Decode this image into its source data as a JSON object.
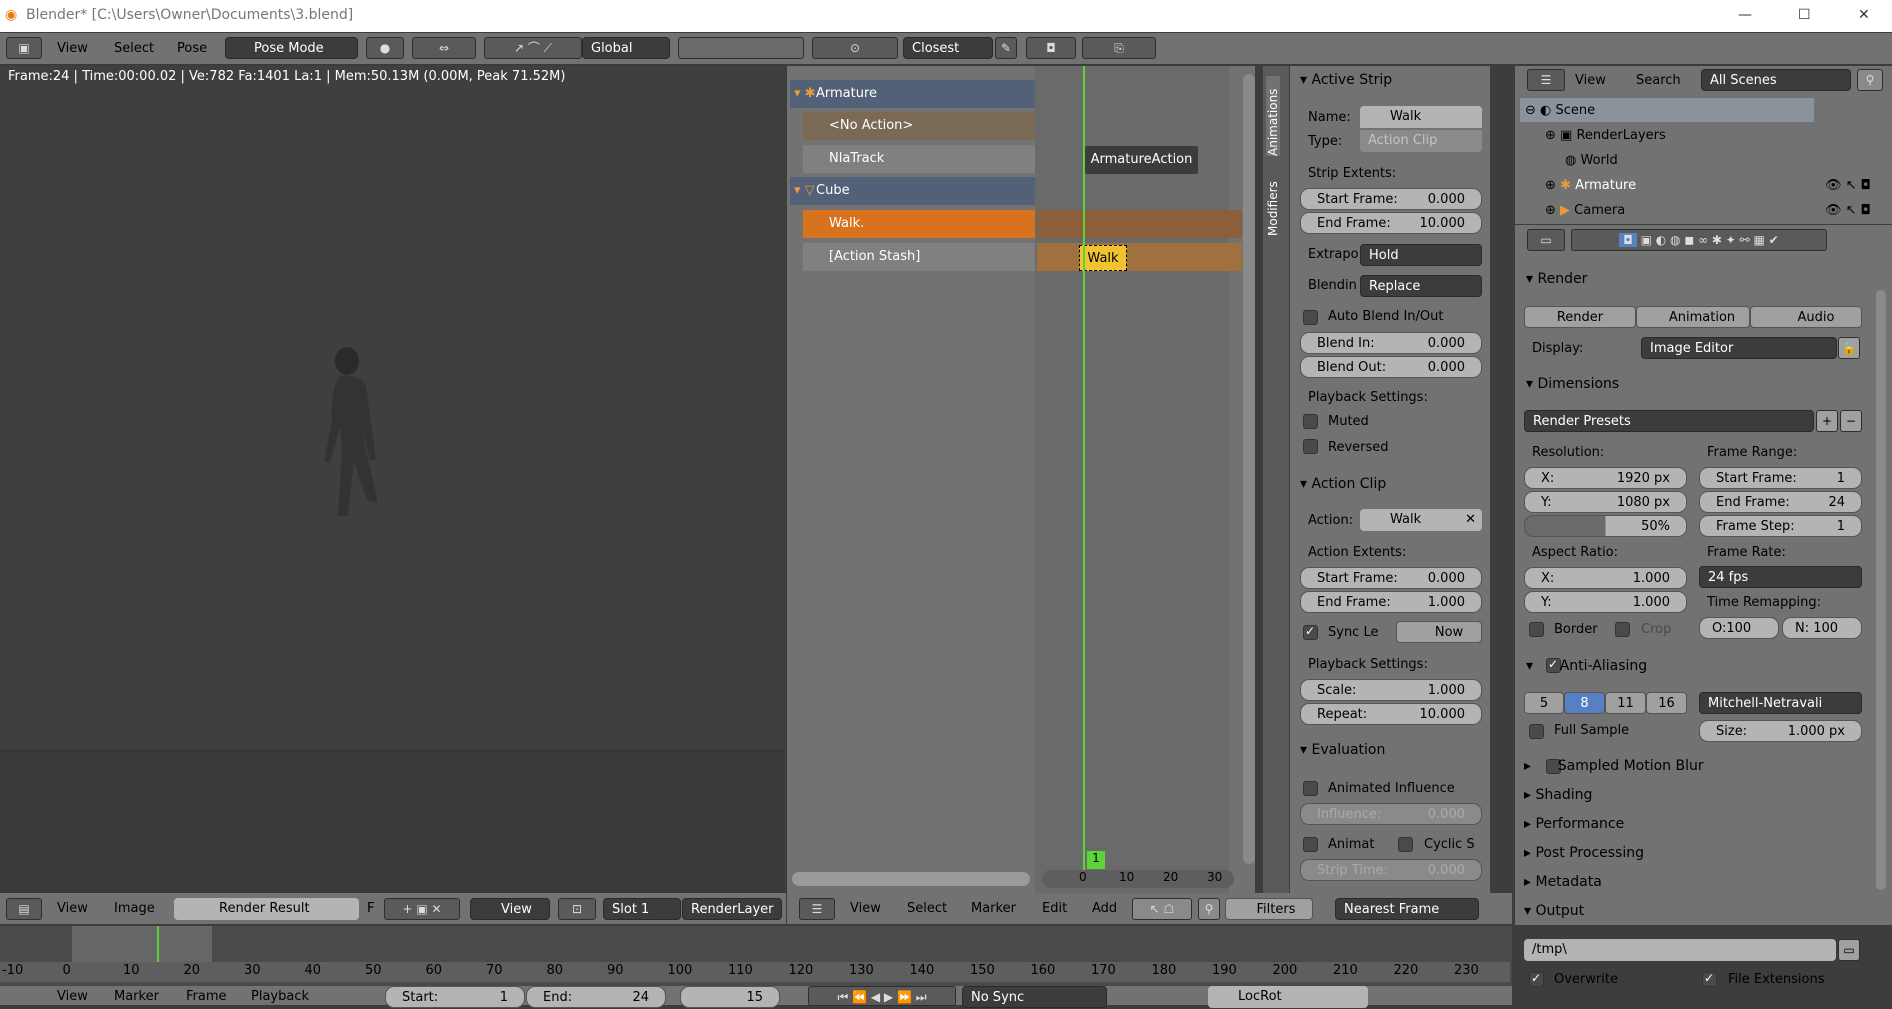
{
  "window": {
    "title": "Blender* [C:\\Users\\Owner\\Documents\\3.blend]",
    "min": "—",
    "max": "☐",
    "close": "✕"
  },
  "header": {
    "view": "View",
    "select": "Select",
    "pose": "Pose",
    "mode": "Pose Mode",
    "orientation": "Global",
    "snap": "Closest"
  },
  "viewport": {
    "info": "Frame:24 | Time:00:00.02 | Ve:782 Fa:1401 La:1 | Mem:50.13M (0.00M, Peak 71.52M)"
  },
  "image_header": {
    "view": "View",
    "image": "Image",
    "image_name": "Render Result",
    "f": "F",
    "view2": "View",
    "slot": "Slot 1",
    "layer": "RenderLayer"
  },
  "nla": {
    "channels": [
      {
        "label": "Armature"
      },
      {
        "label": "<No Action>"
      },
      {
        "label": "NlaTrack"
      },
      {
        "label": "Cube"
      },
      {
        "label": "Walk."
      },
      {
        "label": "[Action Stash]"
      }
    ],
    "strips": {
      "armature_action": "ArmatureAction",
      "walk": "Walk"
    },
    "current_frame": "1",
    "ruler": [
      "0",
      "10",
      "20",
      "30"
    ],
    "tabs": [
      "Animations",
      "Modifiers"
    ],
    "header": {
      "view": "View",
      "select": "Select",
      "marker": "Marker",
      "edit": "Edit",
      "add": "Add",
      "filters": "Filters",
      "snap": "Nearest Frame"
    }
  },
  "strip_panel": {
    "active_strip": "Active Strip",
    "name_label": "Name:",
    "name": "Walk",
    "type_label": "Type:",
    "type": "Action Clip",
    "strip_extents": "Strip Extents:",
    "start_label": "Start Frame:",
    "start": "0.000",
    "end_label": "End Frame:",
    "end": "10.000",
    "extrapo_label": "Extrapo",
    "extrapo": "Hold",
    "blend_label": "Blendin",
    "blend": "Replace",
    "auto_blend": "Auto Blend In/Out",
    "blend_in_label": "Blend In:",
    "blend_in": "0.000",
    "blend_out_label": "Blend Out:",
    "blend_out": "0.000",
    "playback": "Playback Settings:",
    "muted": "Muted",
    "reversed": "Reversed",
    "action_clip": "Action Clip",
    "action_label": "Action:",
    "action": "Walk",
    "action_extents": "Action Extents:",
    "a_start": "0.000",
    "a_end": "1.000",
    "sync": "Sync Le",
    "now": "Now",
    "playback2": "Playback Settings:",
    "scale_label": "Scale:",
    "scale": "1.000",
    "repeat_label": "Repeat:",
    "repeat": "10.000",
    "evaluation": "Evaluation",
    "animated_influence": "Animated Influence",
    "influence_label": "Influence:",
    "influence": "0.000",
    "animat": "Animat",
    "cyclic": "Cyclic S",
    "strip_time_label": "Strip Time:",
    "strip_time": "0.000"
  },
  "outliner": {
    "view": "View",
    "search": "Search",
    "scenes": "All Scenes",
    "items": [
      {
        "label": "Scene"
      },
      {
        "label": "RenderLayers"
      },
      {
        "label": "World"
      },
      {
        "label": "Armature"
      },
      {
        "label": "Camera"
      }
    ]
  },
  "properties": {
    "render": "Render",
    "render_btn": "Render",
    "animation_btn": "Animation",
    "audio_btn": "Audio",
    "display_label": "Display:",
    "display": "Image Editor",
    "dimensions": "Dimensions",
    "presets": "Render Presets",
    "resolution": "Resolution:",
    "res_x": "1920 px",
    "res_y": "1080 px",
    "res_pct": "50%",
    "res_pct_value": 50,
    "frame_range": "Frame Range:",
    "start_frame": "1",
    "end_frame": "24",
    "frame_step": "1",
    "start_label": "Start Frame:",
    "end_label": "End Frame:",
    "step_label": "Frame Step:",
    "aspect": "Aspect Ratio:",
    "asp_x": "1.000",
    "asp_y": "1.000",
    "frame_rate": "Frame Rate:",
    "fps": "24 fps",
    "time_remap": "Time Remapping:",
    "old": "O:100",
    "new": "N: 100",
    "border": "Border",
    "crop": "Crop",
    "anti_aliasing": "Anti-Aliasing",
    "aa_samples": [
      "5",
      "8",
      "11",
      "16"
    ],
    "aa_selected": "8",
    "filter": "Mitchell-Netravali",
    "full_sample": "Full Sample",
    "size_label": "Size:",
    "size": "1.000 px",
    "sections": [
      "Sampled Motion Blur",
      "Shading",
      "Performance",
      "Post Processing",
      "Metadata",
      "Output"
    ],
    "output_path": "/tmp\\",
    "overwrite": "Overwrite",
    "file_ext": "File Extensions"
  },
  "timeline": {
    "ticks": [
      "-10",
      "0",
      "10",
      "20",
      "30",
      "40",
      "50",
      "60",
      "70",
      "80",
      "90",
      "100",
      "110",
      "120",
      "130",
      "140",
      "150",
      "160",
      "170",
      "180",
      "190",
      "200",
      "210",
      "220",
      "230"
    ],
    "view": "View",
    "marker": "Marker",
    "frame": "Frame",
    "playback": "Playback",
    "start_label": "Start:",
    "start": "1",
    "end_label": "End:",
    "end": "24",
    "current": "15",
    "sync": "No Sync",
    "keying": "LocRot"
  },
  "colors": {
    "accent": "#5680c2",
    "selected_strip": "#d9721f",
    "frame_line": "#5bd33a"
  }
}
